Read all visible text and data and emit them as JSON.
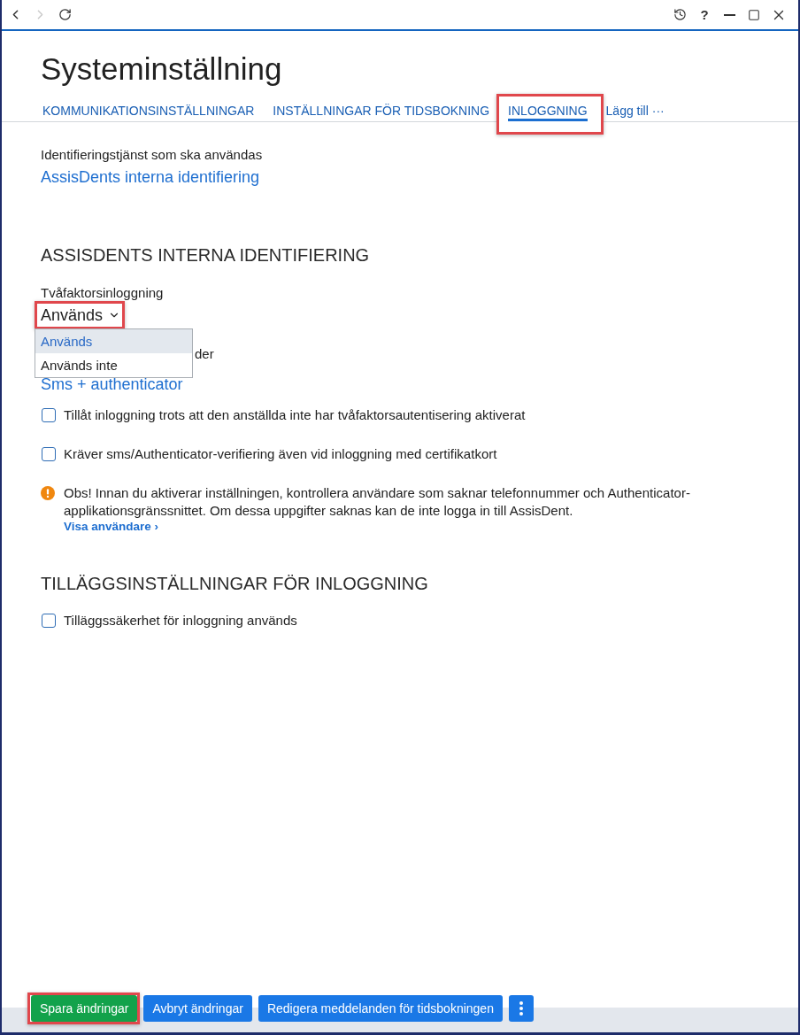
{
  "window": {
    "nav_buttons": [
      {
        "kind": "back",
        "disabled": false
      },
      {
        "kind": "forward",
        "disabled": true
      },
      {
        "kind": "refresh",
        "disabled": false
      }
    ],
    "controls": [
      {
        "kind": "history"
      },
      {
        "kind": "help",
        "label": "?"
      },
      {
        "kind": "minimize"
      },
      {
        "kind": "maximize"
      },
      {
        "kind": "close"
      }
    ]
  },
  "page": {
    "title": "Systeminställning"
  },
  "tabs": [
    {
      "label": "KOMMUNIKATIONSINSTÄLLNINGAR",
      "selected": false,
      "highlighted": false
    },
    {
      "label": "INSTÄLLNINGAR FÖR TIDSBOKNING",
      "selected": false,
      "highlighted": false
    },
    {
      "label": "INLOGGNING",
      "selected": true,
      "highlighted": true
    }
  ],
  "tabs_more": {
    "label": "Lägg till ···"
  },
  "identity_service": {
    "label": "Identifieringstjänst som ska användas",
    "value": "AssisDents interna identifiering"
  },
  "sections": [
    {
      "heading": "ASSISDENTS INTERNA IDENTIFIERING",
      "items": [
        {
          "kind": "select",
          "label": "Tvåfaktorsinloggning",
          "value": "Används",
          "expanded": true,
          "highlighted": true,
          "options": [
            {
              "label": "Används",
              "selected": true
            },
            {
              "label": "Används inte",
              "selected": false
            }
          ]
        },
        {
          "kind": "field",
          "label": "der",
          "value": "Sms + authenticator"
        },
        {
          "kind": "checkbox",
          "label": "Tillåt inloggning trots att den anställda inte har tvåfaktorsautentisering aktiverat",
          "checked": false
        },
        {
          "kind": "checkbox",
          "label": "Kräver sms/Authenticator-verifiering även vid inloggning med certifikatkort",
          "checked": false
        },
        {
          "kind": "notice",
          "text": "Obs! Innan du aktiverar inställningen, kontrollera användare som saknar telefonnummer och Authenticator-applikationsgränssnittet. Om dessa uppgifter saknas kan de inte logga in till AssisDent.",
          "link": "Visa användare ›"
        }
      ]
    },
    {
      "heading": "TILLÄGGSINSTÄLLNINGAR FÖR INLOGGNING",
      "items": [
        {
          "kind": "checkbox",
          "label": "Tilläggssäkerhet för inloggning används",
          "checked": false
        }
      ]
    }
  ],
  "footer": {
    "buttons": [
      {
        "kind": "primary",
        "label": "Spara ändringar",
        "highlighted": true
      },
      {
        "kind": "secondary",
        "label": "Avbryt ändringar",
        "highlighted": false
      },
      {
        "kind": "secondary",
        "label": "Redigera meddelanden för tidsbokningen",
        "highlighted": false
      },
      {
        "kind": "more",
        "highlighted": false
      }
    ]
  }
}
